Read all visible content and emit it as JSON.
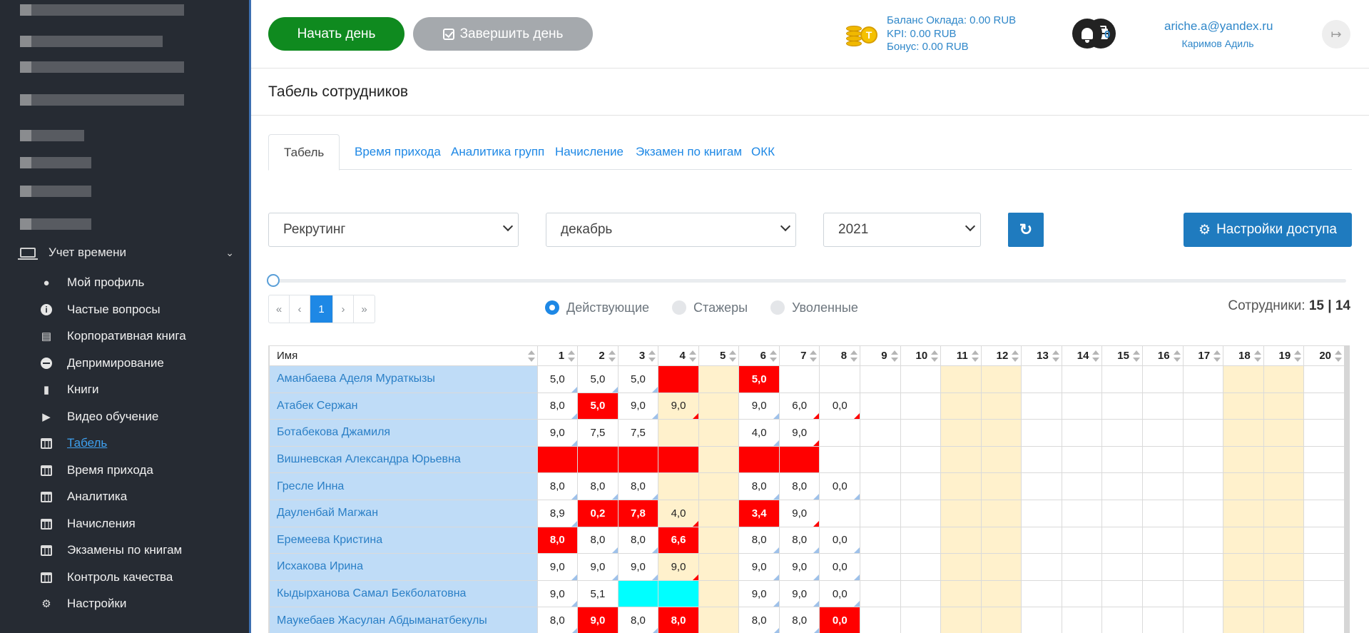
{
  "sidebar": {
    "section": {
      "label": "Учет времени",
      "icon": "laptop-icon"
    },
    "items": [
      {
        "label": "Мой профиль",
        "icon": "user-icon"
      },
      {
        "label": "Частые вопросы",
        "icon": "info-icon"
      },
      {
        "label": "Корпоративная книга",
        "icon": "address-book-icon"
      },
      {
        "label": "Депримирование",
        "icon": "minus-circle-icon"
      },
      {
        "label": "Книги",
        "icon": "book-icon"
      },
      {
        "label": "Видео обучение",
        "icon": "play-icon"
      },
      {
        "label": "Табель",
        "icon": "calendar-icon",
        "active": true
      },
      {
        "label": "Время прихода",
        "icon": "calendar-icon"
      },
      {
        "label": "Аналитика",
        "icon": "calendar-icon"
      },
      {
        "label": "Начисления",
        "icon": "calendar-icon"
      },
      {
        "label": "Экзамены по книгам",
        "icon": "calendar-icon"
      },
      {
        "label": "Контроль качества",
        "icon": "calendar-icon"
      },
      {
        "label": "Настройки",
        "icon": "gears-icon"
      }
    ]
  },
  "topbar": {
    "start_day": "Начать день",
    "end_day": "Завершить день",
    "balance": "Баланс Оклада: 0.00 RUB",
    "kpi": "KPI: 0.00 RUB",
    "bonus": "Бонус: 0.00 RUB",
    "notifications": "0",
    "user_email": "ariche.a@yandex.ru",
    "user_name": "Каримов Адиль"
  },
  "page": {
    "title": "Табель сотрудников",
    "tabs": [
      "Табель",
      "Время прихода",
      "Аналитика групп",
      "Начисление",
      "Экзамен по книгам",
      "ОКК"
    ],
    "filters": {
      "group": "Рекрутинг",
      "month": "декабрь",
      "year": "2021"
    },
    "access_button": "Настройки доступа",
    "pager": [
      "«",
      "‹",
      "1",
      "›",
      "»"
    ],
    "radios": [
      "Действующие",
      "Стажеры",
      "Уволенные"
    ],
    "employees_label": "Сотрудники:",
    "employees_count": "15 | 14"
  },
  "colors": {
    "accent": "#1e88e5",
    "start": "#0f8a1f",
    "late": "#ff0000",
    "weekend": "#fff1cc",
    "name_bg": "#bfdcf7",
    "sidebar": "#262b33"
  },
  "table": {
    "name_header": "Имя",
    "days": [
      "1",
      "2",
      "3",
      "4",
      "5",
      "6",
      "7",
      "8",
      "9",
      "10",
      "11",
      "12",
      "13",
      "14",
      "15",
      "16",
      "17",
      "18",
      "19",
      "20"
    ],
    "weekend_days": [
      5,
      11,
      12,
      18,
      19
    ],
    "rows": [
      {
        "name": "Аманбаева Аделя Мураткызы",
        "cells": [
          [
            "5,0",
            "",
            "b"
          ],
          [
            "5,0",
            "",
            "b"
          ],
          [
            "5,0",
            "",
            "b"
          ],
          [
            "",
            "red",
            ""
          ],
          [
            "",
            "",
            ""
          ],
          [
            "5,0",
            "red",
            ""
          ],
          [
            "",
            "",
            ""
          ],
          [
            "",
            "",
            ""
          ]
        ]
      },
      {
        "name": "Атабек Сержан",
        "cells": [
          [
            "8,0",
            "",
            "b"
          ],
          [
            "5,0",
            "red",
            ""
          ],
          [
            "9,0",
            "",
            "b"
          ],
          [
            "9,0",
            "",
            "r"
          ],
          [
            "",
            "",
            ""
          ],
          [
            "9,0",
            "",
            "b"
          ],
          [
            "6,0",
            "",
            "r"
          ],
          [
            "0,0",
            "",
            "r"
          ]
        ]
      },
      {
        "name": "Ботабекова Джамиля",
        "cells": [
          [
            "9,0",
            "",
            "b"
          ],
          [
            "7,5",
            "",
            ""
          ],
          [
            "7,5",
            "",
            ""
          ],
          [
            "",
            "",
            ""
          ],
          [
            "",
            "",
            ""
          ],
          [
            "4,0",
            "",
            "b"
          ],
          [
            "9,0",
            "",
            "r"
          ],
          [
            "",
            "",
            ""
          ]
        ]
      },
      {
        "name": "Вишневская Александра Юрьевна",
        "cells": [
          [
            "",
            "red",
            ""
          ],
          [
            "",
            "red",
            ""
          ],
          [
            "",
            "red",
            ""
          ],
          [
            "",
            "red",
            ""
          ],
          [
            "",
            "",
            ""
          ],
          [
            "",
            "red",
            ""
          ],
          [
            "",
            "red",
            ""
          ],
          [
            "",
            "",
            ""
          ]
        ]
      },
      {
        "name": "Гресле Инна",
        "cells": [
          [
            "8,0",
            "",
            "b"
          ],
          [
            "8,0",
            "",
            "b"
          ],
          [
            "8,0",
            "",
            "b"
          ],
          [
            "",
            "",
            ""
          ],
          [
            "",
            "",
            ""
          ],
          [
            "8,0",
            "",
            "b"
          ],
          [
            "8,0",
            "",
            "b"
          ],
          [
            "0,0",
            "",
            "b"
          ]
        ]
      },
      {
        "name": "Дауленбай Магжан",
        "cells": [
          [
            "8,9",
            "",
            "b"
          ],
          [
            "0,2",
            "red",
            ""
          ],
          [
            "7,8",
            "red",
            ""
          ],
          [
            "4,0",
            "",
            "r"
          ],
          [
            "",
            "",
            ""
          ],
          [
            "3,4",
            "red",
            ""
          ],
          [
            "9,0",
            "",
            "r"
          ],
          [
            "",
            "",
            ""
          ]
        ]
      },
      {
        "name": "Еремеева Кристина",
        "cells": [
          [
            "8,0",
            "red",
            ""
          ],
          [
            "8,0",
            "",
            "b"
          ],
          [
            "8,0",
            "",
            "b"
          ],
          [
            "6,6",
            "red",
            ""
          ],
          [
            "",
            "",
            ""
          ],
          [
            "8,0",
            "",
            "b"
          ],
          [
            "8,0",
            "",
            "b"
          ],
          [
            "0,0",
            "",
            "b"
          ]
        ]
      },
      {
        "name": "Исхакова Ирина",
        "cells": [
          [
            "9,0",
            "",
            "b"
          ],
          [
            "9,0",
            "",
            "b"
          ],
          [
            "9,0",
            "",
            "b"
          ],
          [
            "9,0",
            "",
            "r"
          ],
          [
            "",
            "",
            ""
          ],
          [
            "9,0",
            "",
            "b"
          ],
          [
            "9,0",
            "",
            "b"
          ],
          [
            "0,0",
            "",
            "b"
          ]
        ]
      },
      {
        "name": "Кыдырханова Самал Бекболатовна",
        "cells": [
          [
            "9,0",
            "",
            "b"
          ],
          [
            "5,1",
            "",
            ""
          ],
          [
            "",
            "cyan",
            ""
          ],
          [
            "",
            "cyan",
            ""
          ],
          [
            "",
            "",
            ""
          ],
          [
            "9,0",
            "",
            "b"
          ],
          [
            "9,0",
            "",
            "b"
          ],
          [
            "0,0",
            "",
            "b"
          ]
        ]
      },
      {
        "name": "Маукебаев Жасулан Абдыманатбекулы",
        "cells": [
          [
            "8,0",
            "",
            "b"
          ],
          [
            "9,0",
            "red",
            ""
          ],
          [
            "8,0",
            "",
            "b"
          ],
          [
            "8,0",
            "red",
            ""
          ],
          [
            "",
            "",
            ""
          ],
          [
            "8,0",
            "",
            "b"
          ],
          [
            "8,0",
            "",
            "b"
          ],
          [
            "0,0",
            "red",
            ""
          ]
        ]
      }
    ]
  }
}
